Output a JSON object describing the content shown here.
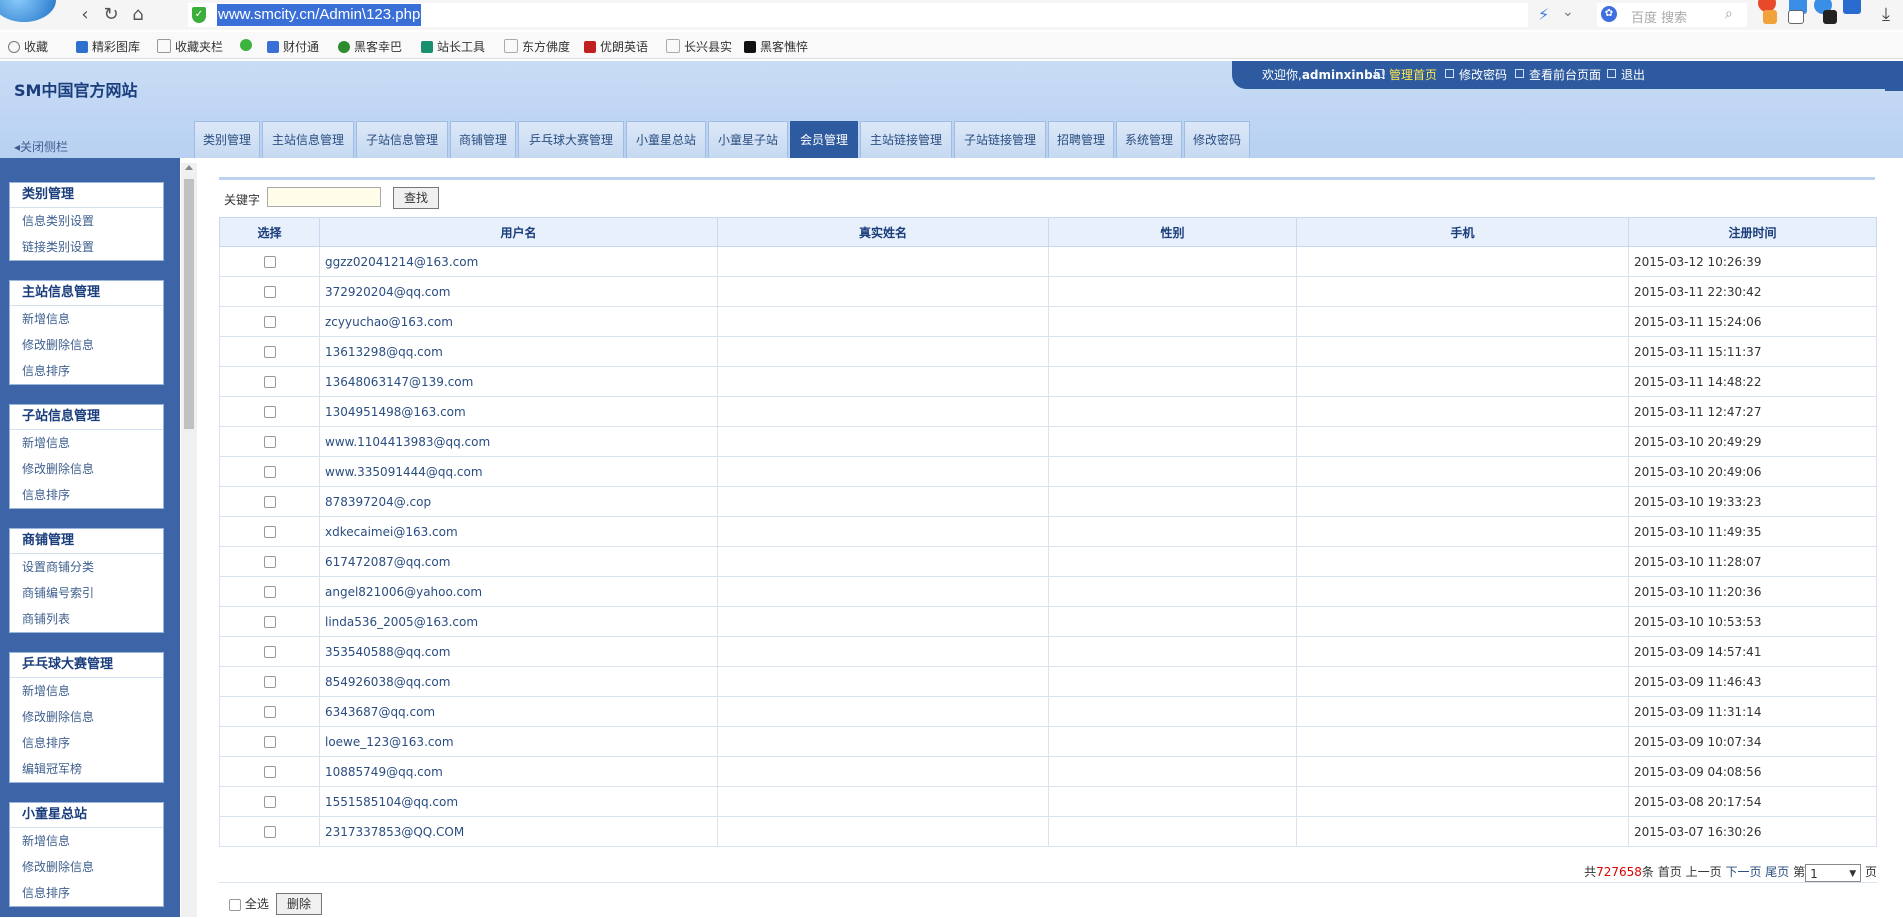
{
  "browser": {
    "url": "www.smcity.cn/Admin\\123.php",
    "search_placeholder": "百度 搜索",
    "nav": {
      "back": "‹",
      "refresh": "↻",
      "home": "⌂"
    },
    "bookmarks": [
      {
        "label": "收藏",
        "icon": "star-icon",
        "color": "#888888"
      },
      {
        "label": "精彩图库",
        "icon": "gallery-icon",
        "color": "#2f6fd0"
      },
      {
        "label": "收藏夹栏",
        "icon": "folder-icon",
        "color": "#999999"
      },
      {
        "label": "",
        "icon": "green-leaf-icon",
        "color": "#3cb33c"
      },
      {
        "label": "财付通",
        "icon": "shield-icon",
        "color": "#3a6fd8"
      },
      {
        "label": "黑客幸巴",
        "icon": "tree-icon",
        "color": "#2e8b2e"
      },
      {
        "label": "站长工具",
        "icon": "tool-icon",
        "color": "#1a8f6f"
      },
      {
        "label": "东方佛度",
        "icon": "page-icon",
        "color": "#aaaaaa"
      },
      {
        "label": "优朗英语",
        "icon": "e-icon",
        "color": "#c02020"
      },
      {
        "label": "长兴县实",
        "icon": "page-icon",
        "color": "#aaaaaa"
      },
      {
        "label": "黑客憔悴",
        "icon": "dark-icon",
        "color": "#111111"
      }
    ]
  },
  "header": {
    "site_title": "SM中国官方网站",
    "welcome": "欢迎你,",
    "username": "adminxinba!",
    "links": [
      "管理首页",
      "修改密码",
      "查看前台页面",
      "退出"
    ],
    "close_sidebar": "关闭侧栏"
  },
  "tabs": [
    {
      "label": "类别管理",
      "active": false
    },
    {
      "label": "主站信息管理",
      "active": false
    },
    {
      "label": "子站信息管理",
      "active": false
    },
    {
      "label": "商铺管理",
      "active": false
    },
    {
      "label": "乒乓球大赛管理",
      "active": false
    },
    {
      "label": "小童星总站",
      "active": false
    },
    {
      "label": "小童星子站",
      "active": false
    },
    {
      "label": "会员管理",
      "active": true
    },
    {
      "label": "主站链接管理",
      "active": false
    },
    {
      "label": "子站链接管理",
      "active": false
    },
    {
      "label": "招聘管理",
      "active": false
    },
    {
      "label": "系统管理",
      "active": false
    },
    {
      "label": "修改密码",
      "active": false
    }
  ],
  "sidebar": [
    {
      "title": "类别管理",
      "items": [
        "信息类别设置",
        "链接类别设置"
      ]
    },
    {
      "title": "主站信息管理",
      "items": [
        "新增信息",
        "修改删除信息",
        "信息排序"
      ]
    },
    {
      "title": "子站信息管理",
      "items": [
        "新增信息",
        "修改删除信息",
        "信息排序"
      ]
    },
    {
      "title": "商铺管理",
      "items": [
        "设置商铺分类",
        "商铺编号索引",
        "商铺列表"
      ]
    },
    {
      "title": "乒乓球大赛管理",
      "items": [
        "新增信息",
        "修改删除信息",
        "信息排序",
        "编辑冠军榜"
      ]
    },
    {
      "title": "小童星总站",
      "items": [
        "新增信息",
        "修改删除信息",
        "信息排序"
      ]
    }
  ],
  "search": {
    "label": "关键字",
    "value": "",
    "button": "查找"
  },
  "table": {
    "headers": [
      "选择",
      "用户名",
      "真实姓名",
      "性别",
      "手机",
      "注册时间"
    ],
    "rows": [
      {
        "user": "ggzz02041214@163.com",
        "name": "",
        "gender": "",
        "phone": "",
        "time": "2015-03-12 10:26:39"
      },
      {
        "user": "372920204@qq.com",
        "name": "",
        "gender": "",
        "phone": "",
        "time": "2015-03-11 22:30:42"
      },
      {
        "user": "zcyyuchao@163.com",
        "name": "",
        "gender": "",
        "phone": "",
        "time": "2015-03-11 15:24:06"
      },
      {
        "user": "13613298@qq.com",
        "name": "",
        "gender": "",
        "phone": "",
        "time": "2015-03-11 15:11:37"
      },
      {
        "user": "13648063147@139.com",
        "name": "",
        "gender": "",
        "phone": "",
        "time": "2015-03-11 14:48:22"
      },
      {
        "user": "1304951498@163.com",
        "name": "",
        "gender": "",
        "phone": "",
        "time": "2015-03-11 12:47:27"
      },
      {
        "user": "www.1104413983@qq.com",
        "name": "",
        "gender": "",
        "phone": "",
        "time": "2015-03-10 20:49:29"
      },
      {
        "user": "www.335091444@qq.com",
        "name": "",
        "gender": "",
        "phone": "",
        "time": "2015-03-10 20:49:06"
      },
      {
        "user": "878397204@.cop",
        "name": "",
        "gender": "",
        "phone": "",
        "time": "2015-03-10 19:33:23"
      },
      {
        "user": "xdkecaimei@163.com",
        "name": "",
        "gender": "",
        "phone": "",
        "time": "2015-03-10 11:49:35"
      },
      {
        "user": "617472087@qq.com",
        "name": "",
        "gender": "",
        "phone": "",
        "time": "2015-03-10 11:28:07"
      },
      {
        "user": "angel821006@yahoo.com",
        "name": "",
        "gender": "",
        "phone": "",
        "time": "2015-03-10 11:20:36"
      },
      {
        "user": "linda536_2005@163.com",
        "name": "",
        "gender": "",
        "phone": "",
        "time": "2015-03-10 10:53:53"
      },
      {
        "user": "353540588@qq.com",
        "name": "",
        "gender": "",
        "phone": "",
        "time": "2015-03-09 14:57:41"
      },
      {
        "user": "854926038@qq.com",
        "name": "",
        "gender": "",
        "phone": "",
        "time": "2015-03-09 11:46:43"
      },
      {
        "user": "6343687@qq.com",
        "name": "",
        "gender": "",
        "phone": "",
        "time": "2015-03-09 11:31:14"
      },
      {
        "user": "loewe_123@163.com",
        "name": "",
        "gender": "",
        "phone": "",
        "time": "2015-03-09 10:07:34"
      },
      {
        "user": "10885749@qq.com",
        "name": "",
        "gender": "",
        "phone": "",
        "time": "2015-03-09 04:08:56"
      },
      {
        "user": "1551585104@qq.com",
        "name": "",
        "gender": "",
        "phone": "",
        "time": "2015-03-08 20:17:54"
      },
      {
        "user": "2317337853@QQ.COM",
        "name": "",
        "gender": "",
        "phone": "",
        "time": "2015-03-07 16:30:26"
      }
    ]
  },
  "pager": {
    "total_prefix": "共",
    "total": "727658",
    "total_suffix": "条",
    "first": "首页",
    "prev": "上一页",
    "next": "下一页",
    "last": "尾页",
    "page_prefix": "第",
    "page_value": "1",
    "page_suffix": "页"
  },
  "footer": {
    "select_all": "全选",
    "delete": "删除"
  },
  "colors": {
    "accent": "#2e5b9f",
    "header_bg": "#c9dcf5",
    "sidebar_bg": "#3e64a8",
    "highlight_link": "#ffe94a"
  }
}
